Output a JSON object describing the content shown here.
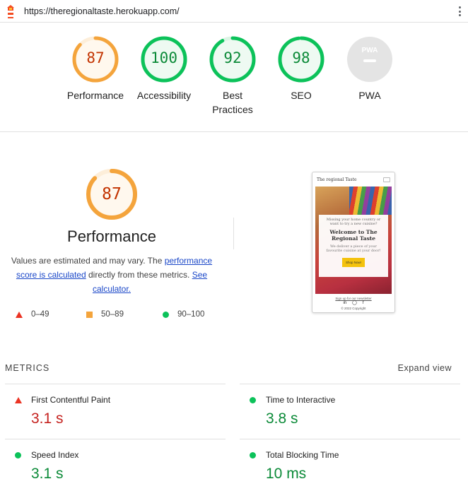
{
  "browser": {
    "url": "https://theregionaltaste.herokuapp.com/"
  },
  "colors": {
    "fail": "#eb3323",
    "average": "#f4a43c",
    "pass": "#0cc25a",
    "pass_text": "#0b8a38",
    "fail_text": "#c5221f",
    "average_text": "#c33300"
  },
  "summary": {
    "gauges": [
      {
        "label": "Performance",
        "score": "87",
        "rating": "average",
        "value": 0.87
      },
      {
        "label": "Accessibility",
        "score": "100",
        "rating": "pass",
        "value": 1.0
      },
      {
        "label": "Best Practices",
        "score": "92",
        "rating": "pass",
        "value": 0.92
      },
      {
        "label": "SEO",
        "score": "98",
        "rating": "pass",
        "value": 0.98
      },
      {
        "label": "PWA",
        "score": "",
        "rating": "na",
        "value": 0,
        "badge": "PWA"
      }
    ]
  },
  "performance": {
    "score": "87",
    "value": 0.87,
    "title": "Performance",
    "desc_prefix": "Values are estimated and may vary. The ",
    "link1": "performance score is calculated",
    "desc_middle": " directly from these metrics. ",
    "link2": "See calculator.",
    "legend": [
      {
        "icon": "triangle-icon",
        "range": "0–49"
      },
      {
        "icon": "square-icon",
        "range": "50–89"
      },
      {
        "icon": "circle-icon",
        "range": "90–100"
      }
    ]
  },
  "thumbnail": {
    "brand": "The regional Taste",
    "line1": "Missing your home country or want to try a new cuisine?",
    "heading": "Welcome to The Regional Taste",
    "line2": "We deliver a piece of your favourite cuisine at your door!",
    "button": "Shop Now!",
    "footer_link": "Sign up for our newsletter",
    "social": [
      "in",
      "◯",
      "f"
    ],
    "copyright": "© 2022 Copyright"
  },
  "metrics": {
    "heading": "METRICS",
    "expand": "Expand view",
    "items": [
      {
        "name": "First Contentful Paint",
        "value": "3.1 s",
        "rating": "fail"
      },
      {
        "name": "Time to Interactive",
        "value": "3.8 s",
        "rating": "pass"
      },
      {
        "name": "Speed Index",
        "value": "3.1 s",
        "rating": "pass"
      },
      {
        "name": "Total Blocking Time",
        "value": "10 ms",
        "rating": "pass"
      }
    ]
  }
}
